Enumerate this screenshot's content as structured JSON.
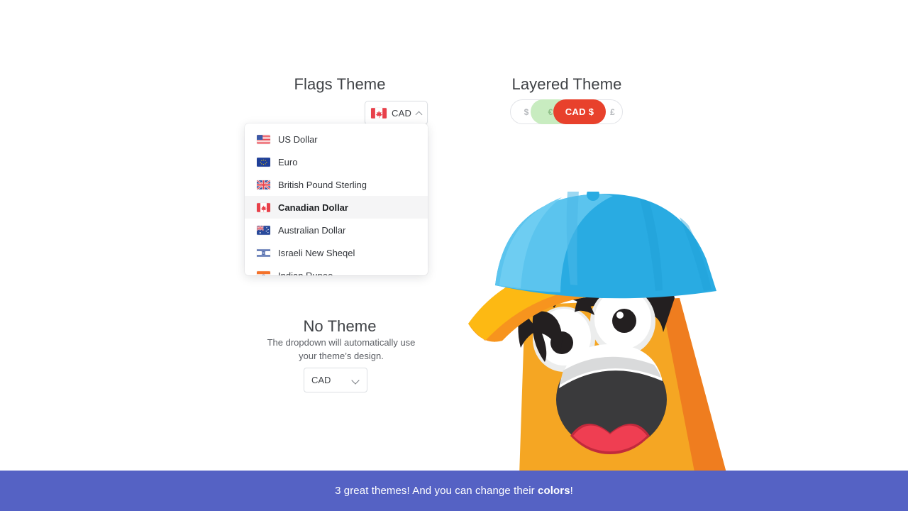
{
  "sections": {
    "flags": {
      "title": "Flags Theme",
      "selector": {
        "value": "CAD",
        "flag": "ca-flag-icon",
        "caret": "caret-up-icon",
        "expanded": true
      },
      "options": [
        {
          "code": "USD",
          "label": "US Dollar",
          "flag": "us-flag-icon",
          "selected": false
        },
        {
          "code": "EUR",
          "label": "Euro",
          "flag": "eu-flag-icon",
          "selected": false
        },
        {
          "code": "GBP",
          "label": "British Pound Sterling",
          "flag": "gb-flag-icon",
          "selected": false
        },
        {
          "code": "CAD",
          "label": "Canadian Dollar",
          "flag": "ca-flag-icon",
          "selected": true
        },
        {
          "code": "AUD",
          "label": "Australian Dollar",
          "flag": "au-flag-icon",
          "selected": false
        },
        {
          "code": "ILS",
          "label": "Israeli New Sheqel",
          "flag": "il-flag-icon",
          "selected": false
        },
        {
          "code": "INR",
          "label": "Indian Rupee",
          "flag": "in-flag-icon",
          "selected": false
        }
      ]
    },
    "layered": {
      "title": "Layered Theme",
      "pills": [
        {
          "label": "$",
          "state": "inactive",
          "color": "#b6b9bd"
        },
        {
          "label": "€",
          "state": "hover",
          "color": "#c8ecc0"
        },
        {
          "label": "CAD $",
          "state": "active",
          "color": "#e8412c"
        },
        {
          "label": "£",
          "state": "inactive",
          "color": "#b6b9bd"
        }
      ]
    },
    "none": {
      "title": "No Theme",
      "subtitle": "The dropdown will automatically use your theme’s design.",
      "select_value": "CAD",
      "chevron": "chevron-down-icon"
    }
  },
  "banner": {
    "text_before": "3 great themes! And you can change their ",
    "text_bold": "colors",
    "text_after": "!",
    "background": "#5562c4"
  },
  "mascot": {
    "name": "orange-mascot-illustration",
    "body_color": "#f5a623",
    "body_shadow": "#ef7d1f",
    "cap_color": "#29abe2",
    "cap_light": "#5bc4ee",
    "brim_color": "#f7941e",
    "brim_light": "#fdb913",
    "hair_color": "#231f20",
    "tongue_color": "#ef3e52",
    "mouth_color": "#3a3a3c"
  }
}
